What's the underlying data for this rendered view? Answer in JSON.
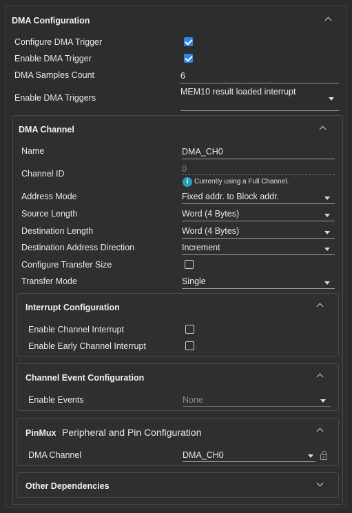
{
  "dma_config": {
    "title": "DMA Configuration",
    "configure_trigger_label": "Configure DMA Trigger",
    "configure_trigger_checked": true,
    "enable_trigger_label": "Enable DMA Trigger",
    "enable_trigger_checked": true,
    "samples_count_label": "DMA Samples Count",
    "samples_count_value": "6",
    "enable_triggers_label": "Enable DMA Triggers",
    "enable_triggers_value": "MEM10 result loaded interrupt"
  },
  "dma_channel": {
    "title": "DMA Channel",
    "name_label": "Name",
    "name_value": "DMA_CH0",
    "channel_id_label": "Channel ID",
    "channel_id_value": "0",
    "channel_id_info": "Currently using a Full Channel.",
    "address_mode_label": "Address Mode",
    "address_mode_value": "Fixed addr. to Block addr.",
    "source_length_label": "Source Length",
    "source_length_value": "Word (4 Bytes)",
    "dest_length_label": "Destination Length",
    "dest_length_value": "Word (4 Bytes)",
    "dest_direction_label": "Destination Address Direction",
    "dest_direction_value": "Increment",
    "transfer_size_label": "Configure Transfer Size",
    "transfer_size_checked": false,
    "transfer_mode_label": "Transfer Mode",
    "transfer_mode_value": "Single"
  },
  "interrupt_config": {
    "title": "Interrupt Configuration",
    "enable_interrupt_label": "Enable Channel Interrupt",
    "enable_early_interrupt_label": "Enable Early Channel Interrupt"
  },
  "channel_event": {
    "title": "Channel Event Configuration",
    "enable_events_label": "Enable Events",
    "enable_events_value": "None"
  },
  "pinmux": {
    "tag": "PinMux",
    "title": "Peripheral and Pin Configuration",
    "dma_channel_label": "DMA Channel",
    "dma_channel_value": "DMA_CH0"
  },
  "other_deps": {
    "title": "Other Dependencies"
  },
  "icons": {
    "info": "i"
  },
  "colors": {
    "checkbox_checked": "#2f86e8",
    "info_icon": "#2a9fb5"
  }
}
